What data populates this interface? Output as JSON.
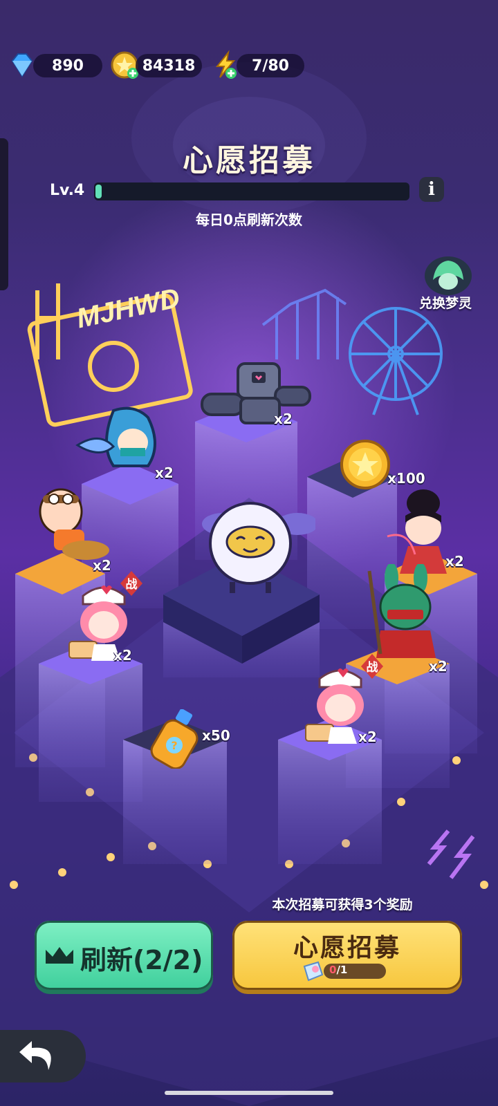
{
  "resources": {
    "gems": "890",
    "coins": "84318",
    "energy": "7/80"
  },
  "header": {
    "title": "心愿招募",
    "level": "Lv.4",
    "level_progress": 0.02,
    "subtitle": "每日0点刷新次数"
  },
  "exchange": {
    "label": "兑换梦灵"
  },
  "neon_sign": {
    "text": "MJHWD"
  },
  "rewards": [
    {
      "name": "robot-hero",
      "qty": "x2"
    },
    {
      "name": "hooded-hero",
      "qty": "x2"
    },
    {
      "name": "gold-coin",
      "qty": "x100"
    },
    {
      "name": "pilot-hero",
      "qty": "x2"
    },
    {
      "name": "ninja-girl-hero",
      "qty": "x2"
    },
    {
      "name": "nurse-hero-left",
      "qty": "x2",
      "badge": "战"
    },
    {
      "name": "rabbit-warrior-hero",
      "qty": "x2",
      "badge": "战"
    },
    {
      "name": "potion-bottle",
      "qty": "x50"
    },
    {
      "name": "nurse-hero-right",
      "qty": "x2"
    }
  ],
  "hint": "本次招募可获得3个奖励",
  "buttons": {
    "refresh": "刷新(2/2)",
    "wish": "心愿招募",
    "cost_have": "0",
    "cost_total": "/1"
  },
  "colors": {
    "refresh_button": "#3fcf9c",
    "wish_button": "#f7c63c",
    "progress": "#62e0b8",
    "background": "#4a2f8c"
  }
}
